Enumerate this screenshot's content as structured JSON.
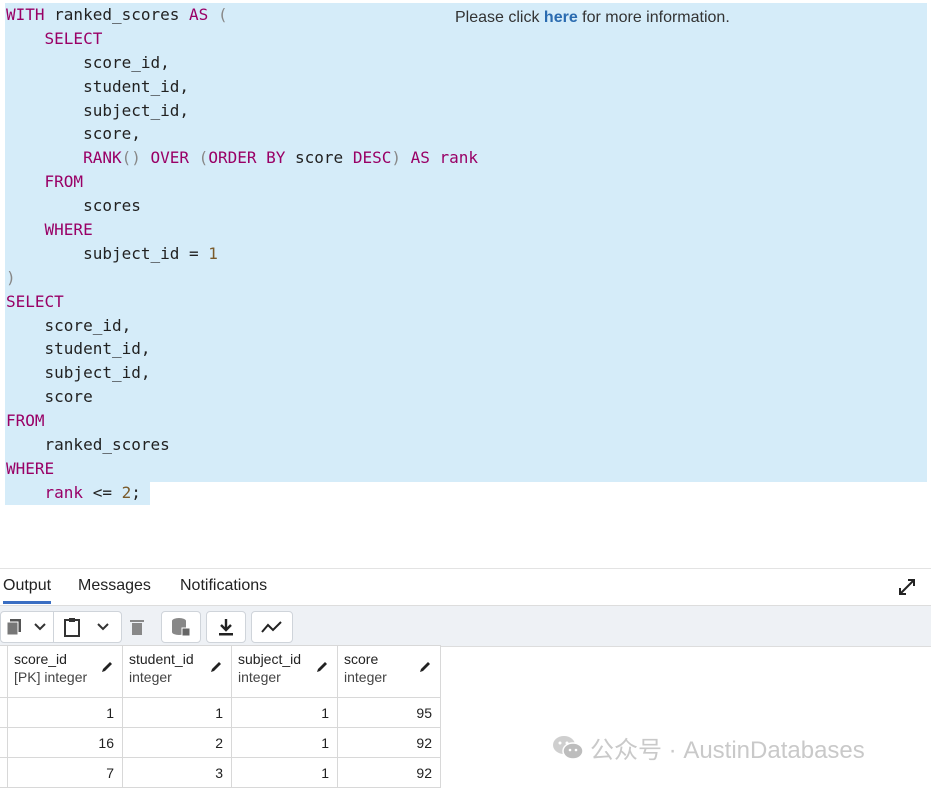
{
  "editor": {
    "info_prefix": "Please click ",
    "info_link": "here",
    "info_suffix": " for more information.",
    "lines": [
      [
        {
          "t": "WITH",
          "c": "kw"
        },
        {
          "t": " ranked_scores "
        },
        {
          "t": "AS",
          "c": "kw"
        },
        {
          "t": " "
        },
        {
          "t": "(",
          "c": "pn"
        }
      ],
      [
        {
          "t": "    "
        },
        {
          "t": "SELECT",
          "c": "kw"
        }
      ],
      [
        {
          "t": "        score_id,"
        }
      ],
      [
        {
          "t": "        student_id,"
        }
      ],
      [
        {
          "t": "        subject_id,"
        }
      ],
      [
        {
          "t": "        score,"
        }
      ],
      [
        {
          "t": "        "
        },
        {
          "t": "RANK",
          "c": "kw"
        },
        {
          "t": "()",
          "c": "pn"
        },
        {
          "t": " "
        },
        {
          "t": "OVER",
          "c": "kw"
        },
        {
          "t": " "
        },
        {
          "t": "(",
          "c": "pn"
        },
        {
          "t": "ORDER BY",
          "c": "kw"
        },
        {
          "t": " score "
        },
        {
          "t": "DESC",
          "c": "kw"
        },
        {
          "t": ")",
          "c": "pn"
        },
        {
          "t": " "
        },
        {
          "t": "AS",
          "c": "kw"
        },
        {
          "t": " "
        },
        {
          "t": "rank",
          "c": "kw"
        }
      ],
      [
        {
          "t": "    "
        },
        {
          "t": "FROM",
          "c": "kw"
        }
      ],
      [
        {
          "t": "        scores"
        }
      ],
      [
        {
          "t": "    "
        },
        {
          "t": "WHERE",
          "c": "kw"
        }
      ],
      [
        {
          "t": "        subject_id = "
        },
        {
          "t": "1",
          "c": "num"
        }
      ],
      [
        {
          "t": ")",
          "c": "pn"
        }
      ],
      [
        {
          "t": "SELECT",
          "c": "kw"
        }
      ],
      [
        {
          "t": "    score_id,"
        }
      ],
      [
        {
          "t": "    student_id,"
        }
      ],
      [
        {
          "t": "    subject_id,"
        }
      ],
      [
        {
          "t": "    score"
        }
      ],
      [
        {
          "t": "FROM",
          "c": "kw"
        }
      ],
      [
        {
          "t": "    ranked_scores"
        }
      ],
      [
        {
          "t": "WHERE",
          "c": "kw"
        }
      ],
      [
        {
          "t": "    "
        },
        {
          "t": "rank",
          "c": "kw"
        },
        {
          "t": " <= "
        },
        {
          "t": "2",
          "c": "num"
        },
        {
          "t": ";"
        }
      ]
    ]
  },
  "tabs": [
    {
      "label": "Output",
      "active": true
    },
    {
      "label": "Messages",
      "active": false
    },
    {
      "label": "Notifications",
      "active": false
    }
  ],
  "toolbar": {
    "icons": [
      "copy-icon",
      "chevron-down-icon",
      "paste-icon",
      "chevron-down-icon",
      "delete-icon",
      "save-data-icon",
      "download-icon",
      "graph-icon"
    ]
  },
  "grid": {
    "columns": [
      {
        "name": "score_id",
        "type": "[PK] integer"
      },
      {
        "name": "student_id",
        "type": "integer"
      },
      {
        "name": "subject_id",
        "type": "integer"
      },
      {
        "name": "score",
        "type": "integer"
      }
    ],
    "rows": [
      [
        "1",
        "1",
        "1",
        "95"
      ],
      [
        "16",
        "2",
        "1",
        "92"
      ],
      [
        "7",
        "3",
        "1",
        "92"
      ]
    ]
  },
  "watermark": {
    "text": "公众号 · AustinDatabases"
  },
  "colors": {
    "keyword": "#990066",
    "selection": "#d5ecf9",
    "link": "#2a6bb0",
    "tab_active": "#3a6ec3"
  }
}
